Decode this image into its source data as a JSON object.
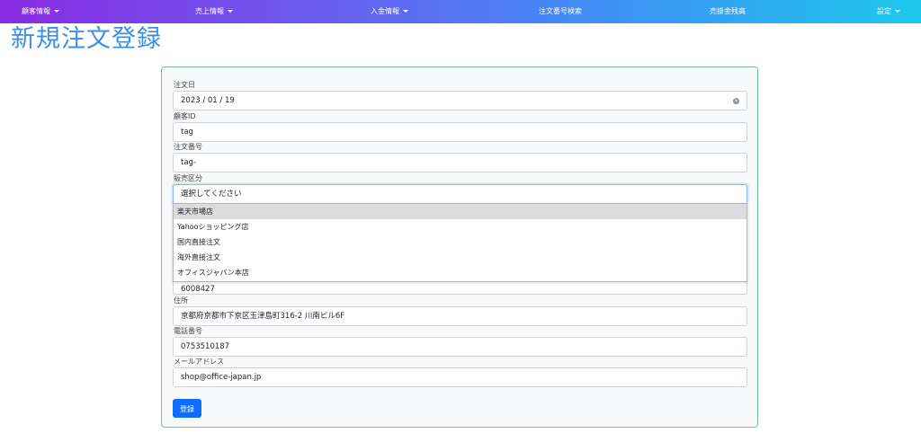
{
  "nav": {
    "customer": "顧客情報",
    "sales": "売上情報",
    "payment": "入金情報",
    "order_search": "注文番号検索",
    "receivable": "売掛金残高",
    "settings": "設定"
  },
  "page": {
    "title": "新規注文登録"
  },
  "form": {
    "order_date": {
      "label": "注文日",
      "value": "2023 / 01 / 19"
    },
    "customer_id": {
      "label": "顧客ID",
      "value": "tag"
    },
    "order_number": {
      "label": "注文番号",
      "value": "tag-"
    },
    "sales_type": {
      "label": "販売区分",
      "value": "選択してください",
      "options": [
        "楽天市場店",
        "Yahooショッピング店",
        "国内直接注文",
        "海外直接注文",
        "オフィスジャパン本店"
      ]
    },
    "postal_code": {
      "value": "6008427"
    },
    "address": {
      "label": "住所",
      "value": "京都府京都市下京区玉津島町316-2 川南ビル6F"
    },
    "phone": {
      "label": "電話番号",
      "value": "0753510187"
    },
    "email": {
      "label": "メールアドレス",
      "value": "shop@office-japan.jp"
    },
    "submit_label": "登録"
  }
}
